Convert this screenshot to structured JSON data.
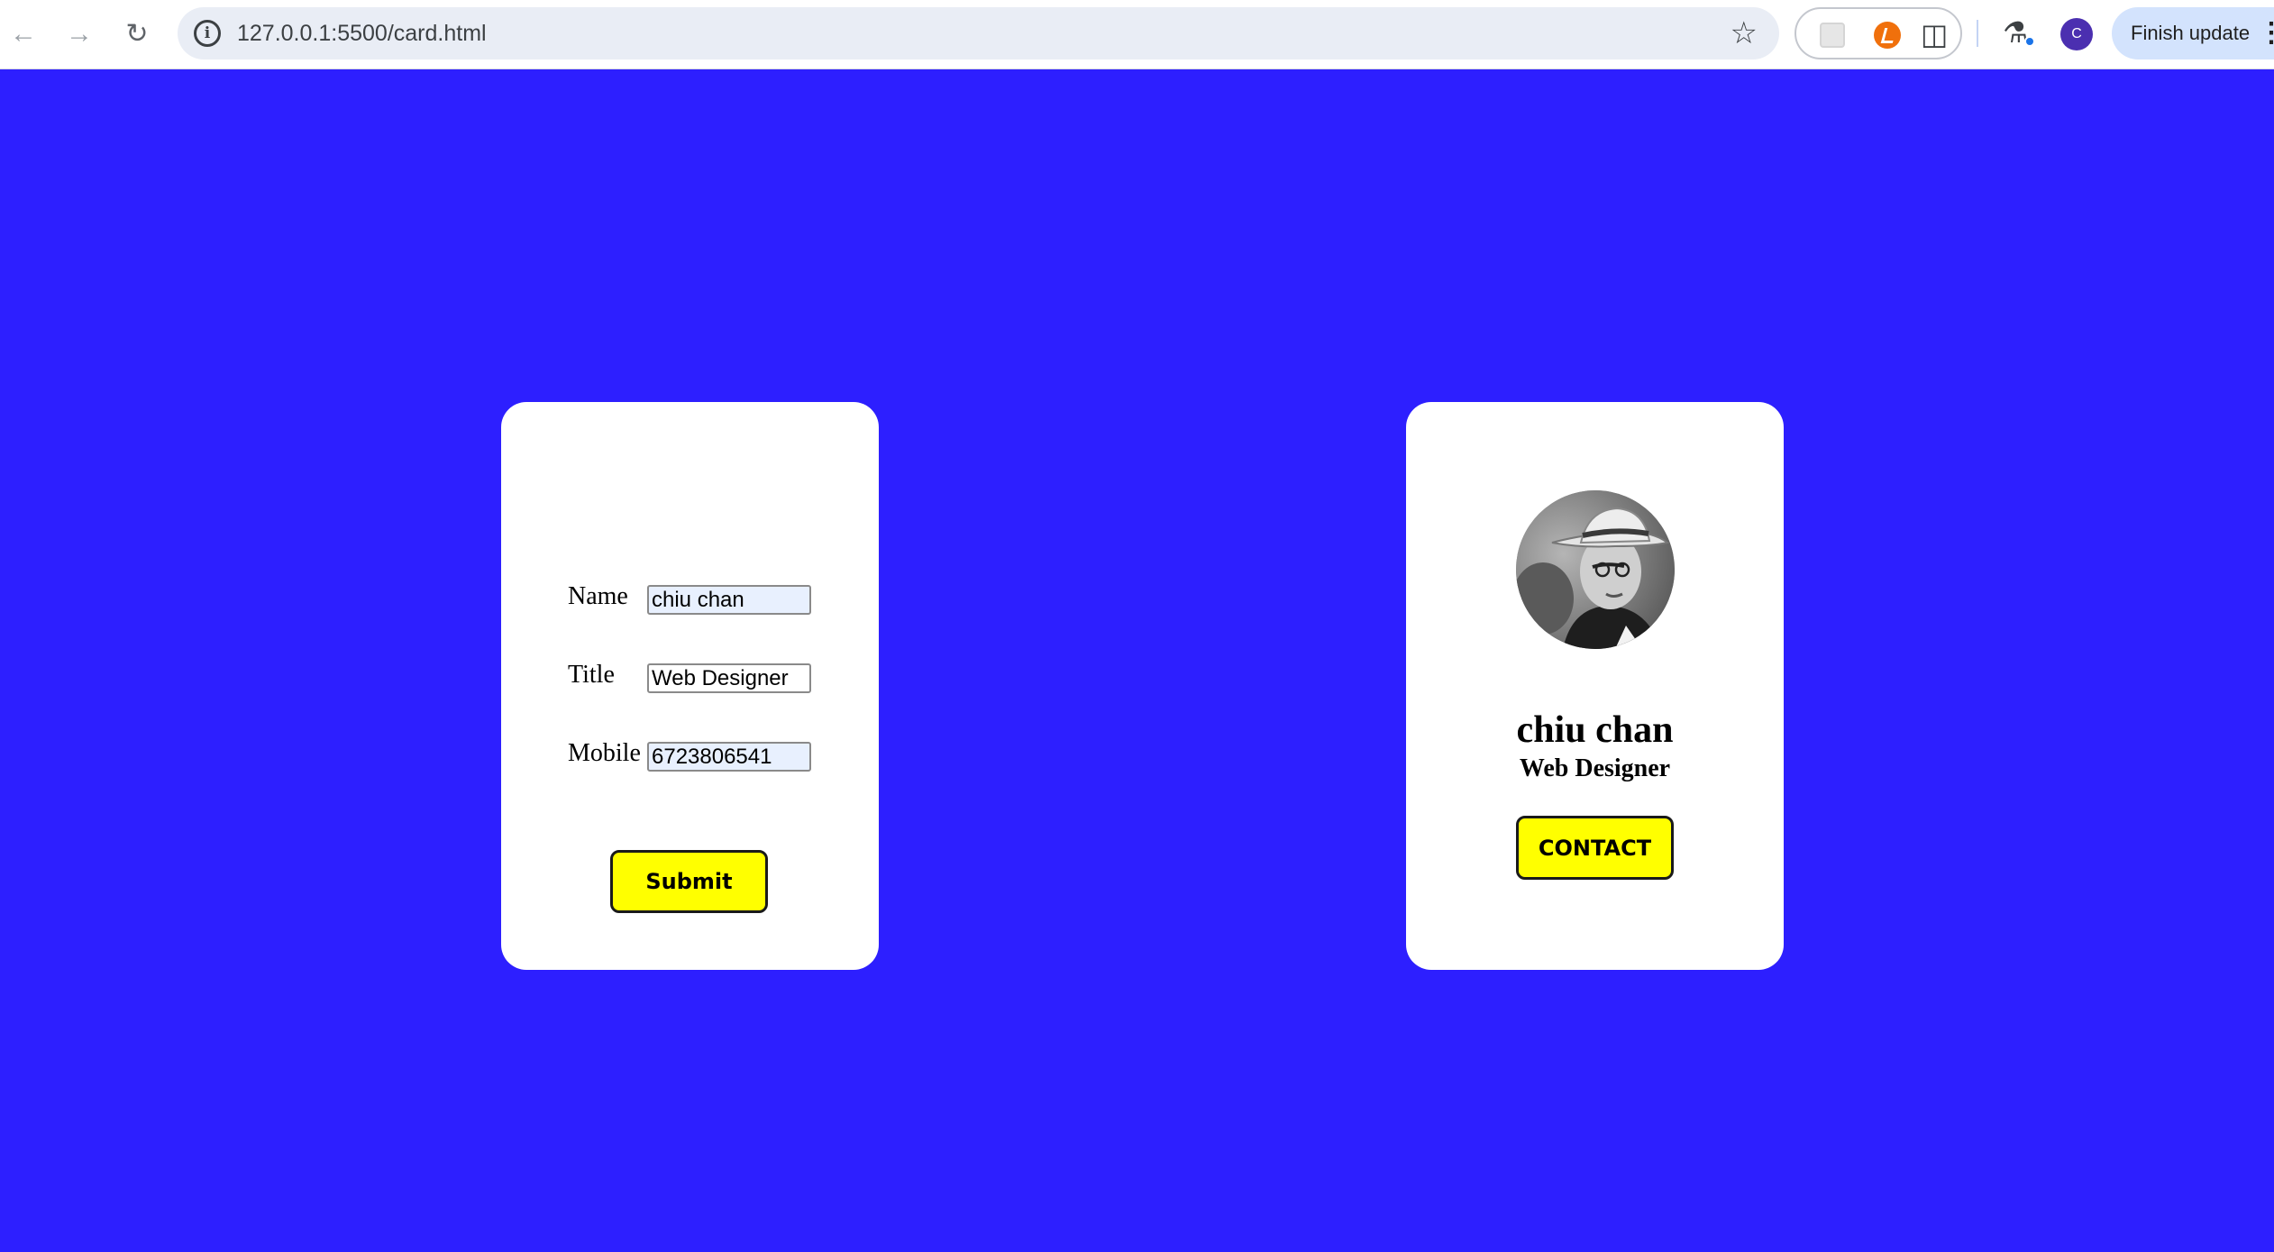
{
  "browser": {
    "url": "127.0.0.1:5500/card.html",
    "finish_update_label": "Finish update",
    "profile_initial": "C",
    "icons": {
      "back": "arrow-left",
      "forward": "arrow-right",
      "reload": "refresh",
      "site_info": "info",
      "bookmark": "star",
      "extensions": "puzzle",
      "labs": "flask",
      "menu": "kebab"
    }
  },
  "form": {
    "name_label": "Name",
    "name_value": "chiu chan",
    "title_label": "Title",
    "title_value": "Web Designer",
    "mobile_label": "Mobile",
    "mobile_value": "6723806541",
    "submit_label": "Submit"
  },
  "profile": {
    "name": "chiu chan",
    "title": "Web Designer",
    "contact_label": "CONTACT"
  },
  "colors": {
    "page_background": "#2d1fff",
    "card_background": "#ffffff",
    "button_yellow": "#ffff00",
    "autofill_blue": "#e8f0fe"
  }
}
